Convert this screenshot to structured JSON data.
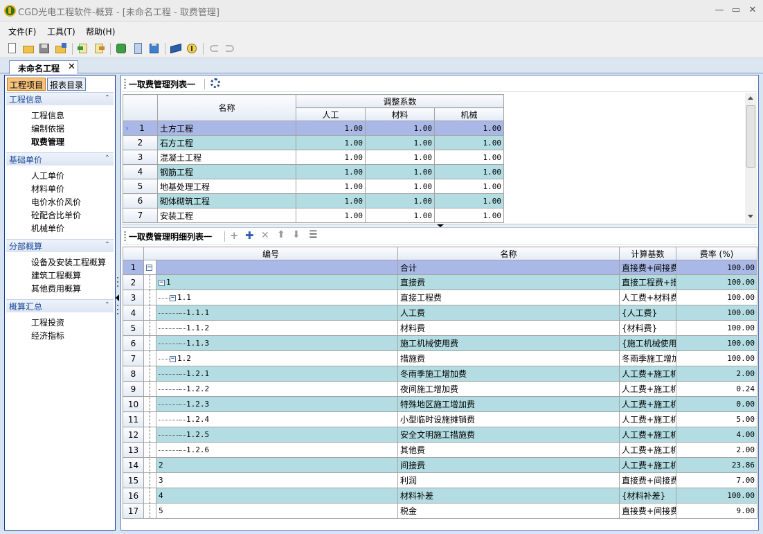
{
  "window": {
    "title": "CGD光电工程软件-概算 - [未命名工程 - 取费管理]",
    "minimize": "—",
    "restore": "▭",
    "close": "✕"
  },
  "menu": [
    "文件(F)",
    "工具(T)",
    "帮助(H)"
  ],
  "toolbar_icons": [
    "new-file-icon",
    "open-folder-icon",
    "save-icon",
    "save-as-icon",
    "import-icon",
    "export-icon",
    "refresh-icon",
    "calculator-icon",
    "clipboard-icon",
    "book-icon",
    "info-icon",
    "undo-icon",
    "redo-icon"
  ],
  "doc_tab": {
    "label": "未命名工程",
    "close": "✕"
  },
  "sidebar": {
    "tabs": [
      "工程项目",
      "报表目录"
    ],
    "sections": [
      {
        "title": "工程信息",
        "items": [
          "工程信息",
          "编制依据",
          "取费管理"
        ]
      },
      {
        "title": "基础单价",
        "items": [
          "人工单价",
          "材料单价",
          "电价水价风价",
          "砼配合比单价",
          "机械单价"
        ]
      },
      {
        "title": "分部概算",
        "items": [
          "设备及安装工程概算",
          "建筑工程概算",
          "其他费用概算"
        ]
      },
      {
        "title": "概算汇总",
        "items": [
          "工程投资",
          "经济指标"
        ]
      }
    ],
    "selected": "取费管理",
    "collapse_glyph": "⌃"
  },
  "top_panel": {
    "title": "一取费管理列表一",
    "headers": {
      "name": "名称",
      "group": "调整系数",
      "labor": "人工",
      "material": "材料",
      "machine": "机械"
    },
    "rows": [
      {
        "no": "1",
        "name": "土方工程",
        "labor": "1.00",
        "material": "1.00",
        "machine": "1.00"
      },
      {
        "no": "2",
        "name": "石方工程",
        "labor": "1.00",
        "material": "1.00",
        "machine": "1.00"
      },
      {
        "no": "3",
        "name": "混凝土工程",
        "labor": "1.00",
        "material": "1.00",
        "machine": "1.00"
      },
      {
        "no": "4",
        "name": "钢筋工程",
        "labor": "1.00",
        "material": "1.00",
        "machine": "1.00"
      },
      {
        "no": "5",
        "name": "地基处理工程",
        "labor": "1.00",
        "material": "1.00",
        "machine": "1.00"
      },
      {
        "no": "6",
        "name": "砌体砌筑工程",
        "labor": "1.00",
        "material": "1.00",
        "machine": "1.00"
      },
      {
        "no": "7",
        "name": "安装工程",
        "labor": "1.00",
        "material": "1.00",
        "machine": "1.00"
      }
    ]
  },
  "bottom_panel": {
    "title": "一取费管理明细列表一",
    "headers": {
      "code": "编号",
      "name": "名称",
      "basis": "计算基数",
      "rate": "费率 (%)"
    },
    "rows": [
      {
        "no": "1",
        "code": "",
        "level": 0,
        "toggle": "−",
        "name": "合计",
        "basis": "直接费+间接费+利润+税金",
        "rate": "100.00"
      },
      {
        "no": "2",
        "code": "1",
        "level": 1,
        "toggle": "−",
        "name": "直接费",
        "basis": "直接工程费+措施费",
        "rate": "100.00"
      },
      {
        "no": "3",
        "code": "1.1",
        "level": 2,
        "toggle": "−",
        "name": "直接工程费",
        "basis": "人工费+材料费+施工机械使用费",
        "rate": "100.00"
      },
      {
        "no": "4",
        "code": "1.1.1",
        "level": 3,
        "toggle": "",
        "name": "人工费",
        "basis": "{人工费}",
        "rate": "100.00"
      },
      {
        "no": "5",
        "code": "1.1.2",
        "level": 3,
        "toggle": "",
        "name": "材料费",
        "basis": "{材料费}",
        "rate": "100.00"
      },
      {
        "no": "6",
        "code": "1.1.3",
        "level": 3,
        "toggle": "",
        "name": "施工机械使用费",
        "basis": "{施工机械使用费}",
        "rate": "100.00"
      },
      {
        "no": "7",
        "code": "1.2",
        "level": 2,
        "toggle": "−",
        "name": "措施费",
        "basis": "冬雨季施工增加费+夜间施工增加费+特殊地区施工增加...",
        "rate": "100.00"
      },
      {
        "no": "8",
        "code": "1.2.1",
        "level": 3,
        "toggle": "",
        "name": "冬雨季施工增加费",
        "basis": "人工费+施工机械使用费",
        "rate": "2.00"
      },
      {
        "no": "9",
        "code": "1.2.2",
        "level": 3,
        "toggle": "",
        "name": "夜间施工增加费",
        "basis": "人工费+施工机械使用费",
        "rate": "0.24"
      },
      {
        "no": "10",
        "code": "1.2.3",
        "level": 3,
        "toggle": "",
        "name": "特殊地区施工增加费",
        "basis": "人工费+施工机械使用费",
        "rate": "0.00"
      },
      {
        "no": "11",
        "code": "1.2.4",
        "level": 3,
        "toggle": "",
        "name": "小型临时设施摊销费",
        "basis": "人工费+施工机械使用费",
        "rate": "5.00"
      },
      {
        "no": "12",
        "code": "1.2.5",
        "level": 3,
        "toggle": "",
        "name": "安全文明施工措施费",
        "basis": "人工费+施工机械使用费",
        "rate": "4.00"
      },
      {
        "no": "13",
        "code": "1.2.6",
        "level": 3,
        "toggle": "",
        "name": "其他费",
        "basis": "人工费+施工机械使用费",
        "rate": "2.00"
      },
      {
        "no": "14",
        "code": "2",
        "level": 1,
        "toggle": "",
        "name": "间接费",
        "basis": "人工费+施工机械使用费",
        "rate": "23.86"
      },
      {
        "no": "15",
        "code": "3",
        "level": 1,
        "toggle": "",
        "name": "利润",
        "basis": "直接费+间接费",
        "rate": "7.00"
      },
      {
        "no": "16",
        "code": "4",
        "level": 1,
        "toggle": "",
        "name": "材料补差",
        "basis": "{材料补差}",
        "rate": "100.00"
      },
      {
        "no": "17",
        "code": "5",
        "level": 1,
        "toggle": "",
        "name": "税金",
        "basis": "直接费+间接费+利润",
        "rate": "9.00"
      }
    ]
  },
  "colors": {
    "selected_row": "#a9b8e6",
    "alt_row": "#b3dde2",
    "header": "#e4ebf5"
  }
}
